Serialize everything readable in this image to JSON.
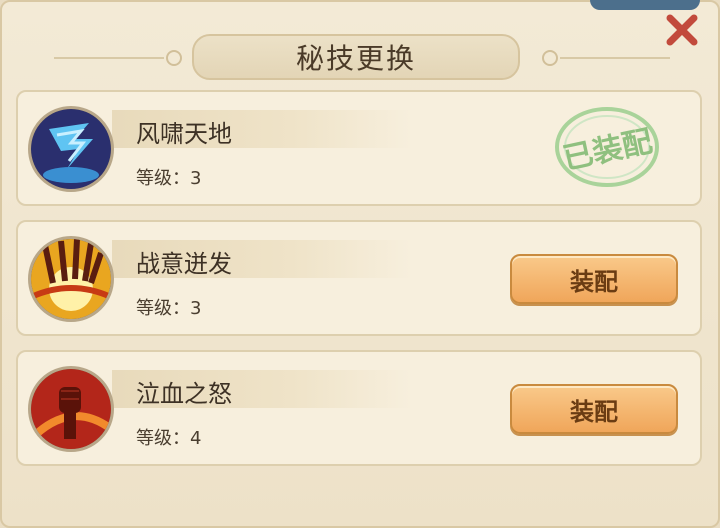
{
  "dialog": {
    "title": "秘技更换",
    "close_icon": "close-x-icon",
    "accent_color": "#f0a65a",
    "stamp_color": "#8fc07f"
  },
  "skills": [
    {
      "name": "风啸天地",
      "level_label": "等级：",
      "level": "3",
      "icon": "whirlwind-skill-icon",
      "status": "已装配"
    },
    {
      "name": "战意迸发",
      "level_label": "等级：",
      "level": "3",
      "icon": "burst-skill-icon",
      "button": "装配"
    },
    {
      "name": "泣血之怒",
      "level_label": "等级：",
      "level": "4",
      "icon": "blood-fist-skill-icon",
      "button": "装配"
    }
  ]
}
